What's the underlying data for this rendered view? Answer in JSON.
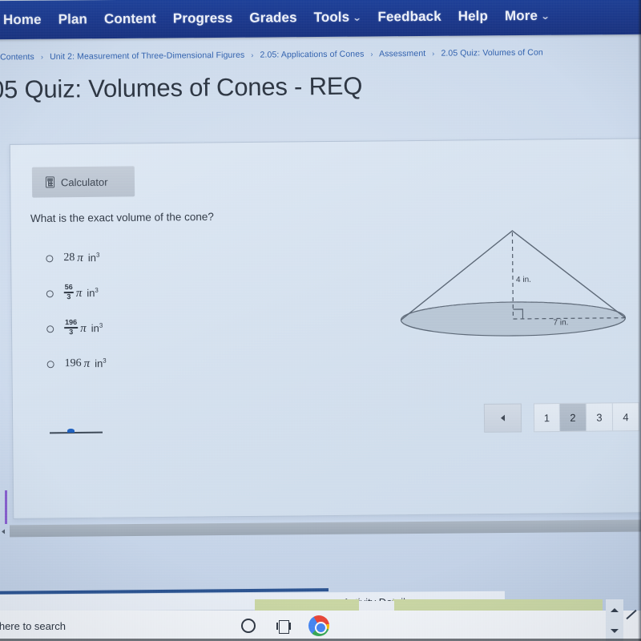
{
  "nav": {
    "items": [
      {
        "label": "Home",
        "caret": false
      },
      {
        "label": "Plan",
        "caret": false
      },
      {
        "label": "Content",
        "caret": false
      },
      {
        "label": "Progress",
        "caret": false
      },
      {
        "label": "Grades",
        "caret": false
      },
      {
        "label": "Tools",
        "caret": true
      },
      {
        "label": "Feedback",
        "caret": false
      },
      {
        "label": "Help",
        "caret": false
      },
      {
        "label": "More",
        "caret": true
      }
    ],
    "caret_glyph": "⌄",
    "background_color": "#18358a"
  },
  "breadcrumb": {
    "separator": "›",
    "items": [
      "f Contents",
      "Unit 2: Measurement of Three-Dimensional Figures",
      "2.05: Applications of Cones",
      "Assessment",
      "2.05 Quiz: Volumes of Con"
    ],
    "link_color": "#2c5ead"
  },
  "page": {
    "title": "05 Quiz: Volumes of Cones - REQ"
  },
  "toolbar": {
    "calculator_label": "Calculator",
    "calculator_icon": "calculator-icon"
  },
  "quiz": {
    "question": "What is the exact volume of the cone?",
    "options": [
      {
        "id": "a",
        "whole": "28",
        "pi": "π",
        "unit": "in",
        "exponent": "3",
        "fraction": null,
        "selected": false
      },
      {
        "id": "b",
        "whole": "",
        "pi": "π",
        "unit": "in",
        "exponent": "3",
        "fraction": {
          "numerator": "56",
          "denominator": "3"
        },
        "selected": false
      },
      {
        "id": "c",
        "whole": "",
        "pi": "π",
        "unit": "in",
        "exponent": "3",
        "fraction": {
          "numerator": "196",
          "denominator": "3"
        },
        "selected": false
      },
      {
        "id": "d",
        "whole": "196",
        "pi": "π",
        "unit": "in",
        "exponent": "3",
        "fraction": null,
        "selected": false
      }
    ]
  },
  "figure": {
    "name": "cone-diagram",
    "height_label": "4 in.",
    "radius_label": "7 in.",
    "fill_color": "#b9c7d6",
    "stroke_color": "#5a6675"
  },
  "pagination": {
    "prev_label": "◄",
    "pages": [
      {
        "label": "1",
        "active": false
      },
      {
        "label": "2",
        "active": true
      },
      {
        "label": "3",
        "active": false
      },
      {
        "label": "4",
        "active": false
      }
    ],
    "active_color": "#a9b5c4",
    "marker_color": "#1c5fbf"
  },
  "footer": {
    "activity_details": "Activity Details"
  },
  "taskbar": {
    "search_text": "e here to search",
    "icons": [
      {
        "name": "cortana-icon"
      },
      {
        "name": "task-view-icon"
      },
      {
        "name": "chrome-icon"
      }
    ]
  },
  "scroll": {
    "h_left_arrow": "◄",
    "v_up_arrow": "⌃",
    "v_down_arrow": "⌄"
  }
}
